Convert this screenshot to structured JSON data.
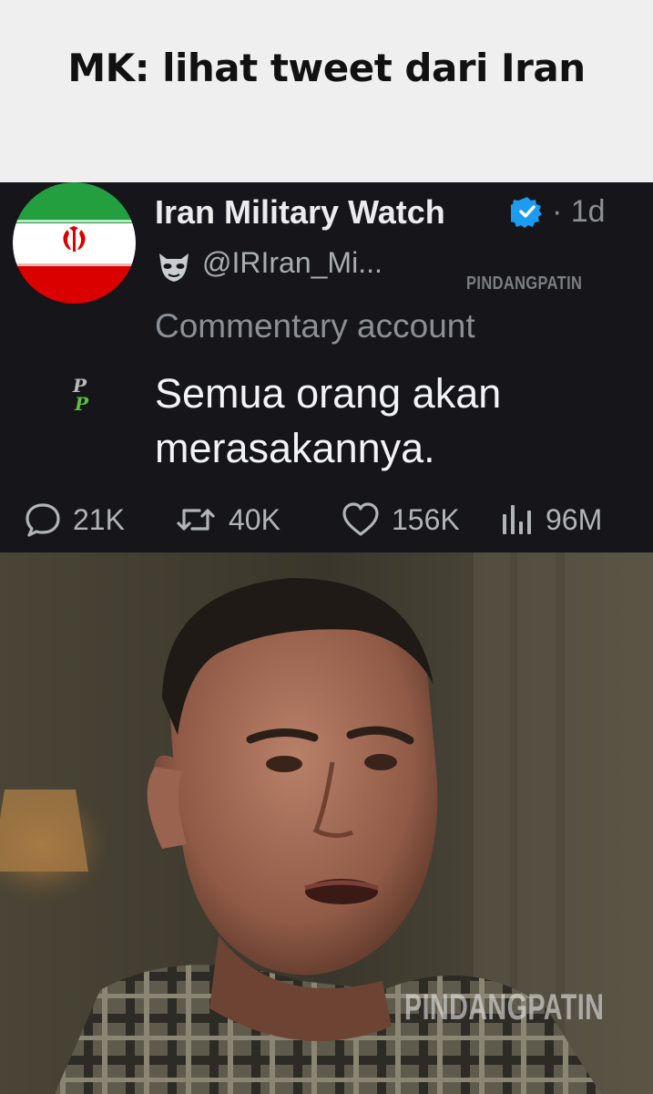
{
  "caption": "MK: lihat tweet dari Iran",
  "tweet": {
    "display_name": "Iran Military Watch",
    "time": "· 1d",
    "handle": "@IRIran_Mi...",
    "affiliation": "Commentary account",
    "text_lines": [
      "Semua orang akan",
      "merasakannya."
    ],
    "metrics": {
      "replies": "21K",
      "reposts": "40K",
      "likes": "156K",
      "views": "96M"
    }
  },
  "watermarks": {
    "small": "PINDANGPATIN",
    "large": "PINDANGPATIN"
  },
  "icons": [
    "iran-flag-avatar",
    "verified-badge-icon",
    "mask-icon",
    "pp-logo-icon",
    "reply-icon",
    "repost-icon",
    "like-icon",
    "views-icon"
  ],
  "colors": {
    "caption_bg": "#efefef",
    "tweet_bg": "#15151a",
    "verified_blue": "#1d9bf0",
    "flag_green": "#239f40",
    "flag_red": "#da0000"
  }
}
